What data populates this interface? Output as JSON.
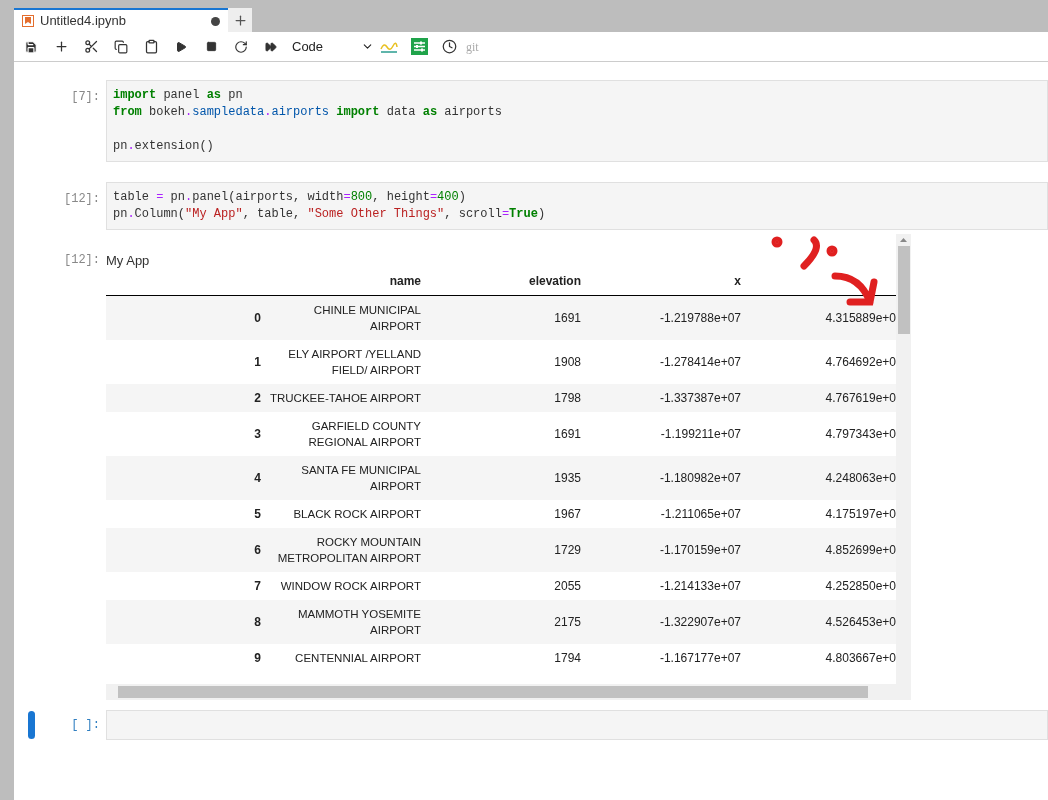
{
  "tab": {
    "title": "Untitled4.ipynb",
    "unsaved": true
  },
  "toolbar": {
    "cell_type": "Code",
    "git_label": "git"
  },
  "cells": [
    {
      "prompt": "[7]:",
      "paragraphs": [
        [
          [
            {
              "t": "import",
              "kind": "kw"
            },
            {
              "t": " panel ",
              "kind": "plain"
            },
            {
              "t": "as",
              "kind": "kw"
            },
            {
              "t": " pn",
              "kind": "plain"
            }
          ],
          [
            {
              "t": "from",
              "kind": "kw"
            },
            {
              "t": " bokeh",
              "kind": "plain"
            },
            {
              "t": ".",
              "kind": "op"
            },
            {
              "t": "sampledata",
              "kind": "mod"
            },
            {
              "t": ".",
              "kind": "op"
            },
            {
              "t": "airports",
              "kind": "mod"
            },
            {
              "t": " import",
              "kind": "kw"
            },
            {
              "t": " data ",
              "kind": "plain"
            },
            {
              "t": "as",
              "kind": "kw"
            },
            {
              "t": " airports",
              "kind": "plain"
            }
          ]
        ],
        [
          [
            {
              "t": "pn",
              "kind": "plain"
            },
            {
              "t": ".",
              "kind": "op"
            },
            {
              "t": "extension()",
              "kind": "plain"
            }
          ]
        ]
      ]
    },
    {
      "prompt": "[12]:",
      "paragraphs": [
        [
          [
            {
              "t": "table ",
              "kind": "plain"
            },
            {
              "t": "=",
              "kind": "op"
            },
            {
              "t": " pn",
              "kind": "plain"
            },
            {
              "t": ".",
              "kind": "op"
            },
            {
              "t": "panel(airports, width",
              "kind": "plain"
            },
            {
              "t": "=",
              "kind": "op"
            },
            {
              "t": "800",
              "kind": "num"
            },
            {
              "t": ", height",
              "kind": "plain"
            },
            {
              "t": "=",
              "kind": "op"
            },
            {
              "t": "400",
              "kind": "num"
            },
            {
              "t": ")",
              "kind": "plain"
            }
          ],
          [
            {
              "t": "pn",
              "kind": "plain"
            },
            {
              "t": ".",
              "kind": "op"
            },
            {
              "t": "Column(",
              "kind": "plain"
            },
            {
              "t": "\"My App\"",
              "kind": "str"
            },
            {
              "t": ", table, ",
              "kind": "plain"
            },
            {
              "t": "\"Some Other Things\"",
              "kind": "str"
            },
            {
              "t": ", scroll",
              "kind": "plain"
            },
            {
              "t": "=",
              "kind": "op"
            },
            {
              "t": "True",
              "kind": "kw"
            },
            {
              "t": ")",
              "kind": "plain"
            }
          ]
        ]
      ]
    }
  ],
  "output": {
    "prompt": "[12]:",
    "title": "My App",
    "columns": [
      "name",
      "elevation",
      "x"
    ],
    "rows": [
      {
        "index": "0",
        "name_lines": [
          "CHINLE MUNICIPAL",
          "AIRPORT"
        ],
        "elevation": "1691",
        "x": "-1.219788e+07",
        "column_4": "4.315889e+0"
      },
      {
        "index": "1",
        "name_lines": [
          "ELY AIRPORT /YELLAND",
          "FIELD/ AIRPORT"
        ],
        "elevation": "1908",
        "x": "-1.278414e+07",
        "column_4": "4.764692e+0"
      },
      {
        "index": "2",
        "name_lines": [
          "TRUCKEE-TAHOE AIRPORT"
        ],
        "elevation": "1798",
        "x": "-1.337387e+07",
        "column_4": "4.767619e+0"
      },
      {
        "index": "3",
        "name_lines": [
          "GARFIELD COUNTY",
          "REGIONAL AIRPORT"
        ],
        "elevation": "1691",
        "x": "-1.199211e+07",
        "column_4": "4.797343e+0"
      },
      {
        "index": "4",
        "name_lines": [
          "SANTA FE MUNICIPAL",
          "AIRPORT"
        ],
        "elevation": "1935",
        "x": "-1.180982e+07",
        "column_4": "4.248063e+0"
      },
      {
        "index": "5",
        "name_lines": [
          "BLACK ROCK AIRPORT"
        ],
        "elevation": "1967",
        "x": "-1.211065e+07",
        "column_4": "4.175197e+0"
      },
      {
        "index": "6",
        "name_lines": [
          "ROCKY MOUNTAIN",
          "METROPOLITAN AIRPORT"
        ],
        "elevation": "1729",
        "x": "-1.170159e+07",
        "column_4": "4.852699e+0"
      },
      {
        "index": "7",
        "name_lines": [
          "WINDOW ROCK AIRPORT"
        ],
        "elevation": "2055",
        "x": "-1.214133e+07",
        "column_4": "4.252850e+0"
      },
      {
        "index": "8",
        "name_lines": [
          "MAMMOTH YOSEMITE",
          "AIRPORT"
        ],
        "elevation": "2175",
        "x": "-1.322907e+07",
        "column_4": "4.526453e+0"
      },
      {
        "index": "9",
        "name_lines": [
          "CENTENNIAL AIRPORT"
        ],
        "elevation": "1794",
        "x": "-1.167177e+07",
        "column_4": "4.803667e+0"
      }
    ]
  },
  "empty_cell": {
    "prompt": "[ ]:",
    "selected": true
  }
}
